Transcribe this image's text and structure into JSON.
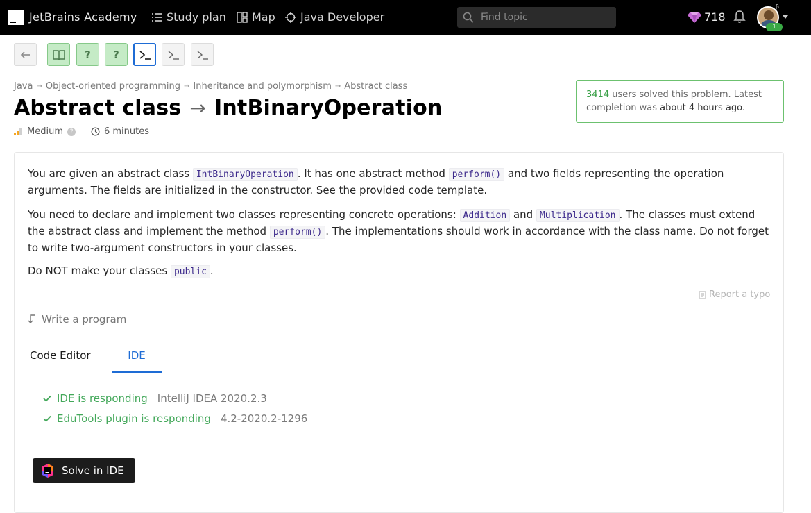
{
  "header": {
    "brand": "JetBrains Academy",
    "nav": [
      {
        "label": "Study plan",
        "icon": "list-icon"
      },
      {
        "label": "Map",
        "icon": "map-icon"
      },
      {
        "label": "Java Developer",
        "icon": "target-icon"
      }
    ],
    "search_placeholder": "Find topic",
    "gems": "718",
    "beta": "β",
    "badge": "1"
  },
  "steps": [
    {
      "kind": "back",
      "icon": "back-arrow-icon"
    },
    {
      "kind": "done",
      "icon": "book-icon"
    },
    {
      "kind": "done",
      "label": "?"
    },
    {
      "kind": "done",
      "label": "?"
    },
    {
      "kind": "current",
      "icon": "terminal-icon"
    },
    {
      "kind": "todo",
      "icon": "terminal-icon"
    },
    {
      "kind": "todo",
      "icon": "terminal-icon"
    }
  ],
  "breadcrumb": [
    "Java",
    "Object-oriented programming",
    "Inheritance and polymorphism",
    "Abstract class"
  ],
  "title": {
    "topic": "Abstract class",
    "problem": "IntBinaryOperation"
  },
  "meta": {
    "difficulty": "Medium",
    "duration": "6 minutes"
  },
  "solved": {
    "count": "3414",
    "text1": " users solved this problem. Latest completion was ",
    "when": "about 4 hours ago",
    "text2": "."
  },
  "description": {
    "p1": {
      "a": "You are given an abstract class ",
      "c1": "IntBinaryOperation",
      "b": ". It has one abstract method ",
      "c2": "perform()",
      "d": " and two fields representing the operation arguments. The fields are initialized in the constructor. See the provided code template."
    },
    "p2": {
      "a": "You need to declare and implement two classes representing concrete operations: ",
      "c1": "Addition",
      "b": " and ",
      "c2": "Multiplication",
      "d": ". The classes must extend the abstract class and implement the method ",
      "c3": "perform()",
      "e": ". The implementations should work in accordance with the class name. Do not forget to write two-argument constructors in your classes."
    },
    "p3": {
      "a": "Do NOT make your classes ",
      "c1": "public",
      "b": "."
    }
  },
  "report_typo": "Report a typo",
  "write_program": "Write a program",
  "tabs": {
    "code_editor": "Code Editor",
    "ide": "IDE"
  },
  "ide_status": [
    {
      "label": "IDE is responding",
      "version": "IntelliJ IDEA 2020.2.3"
    },
    {
      "label": "EduTools plugin is responding",
      "version": "4.2-2020.2-1296"
    }
  ],
  "solve_button": "Solve in IDE",
  "colors": {
    "accent": "#1e6cd5",
    "success": "#43a85a",
    "header": "#000000",
    "gem": "#c86dd7"
  }
}
